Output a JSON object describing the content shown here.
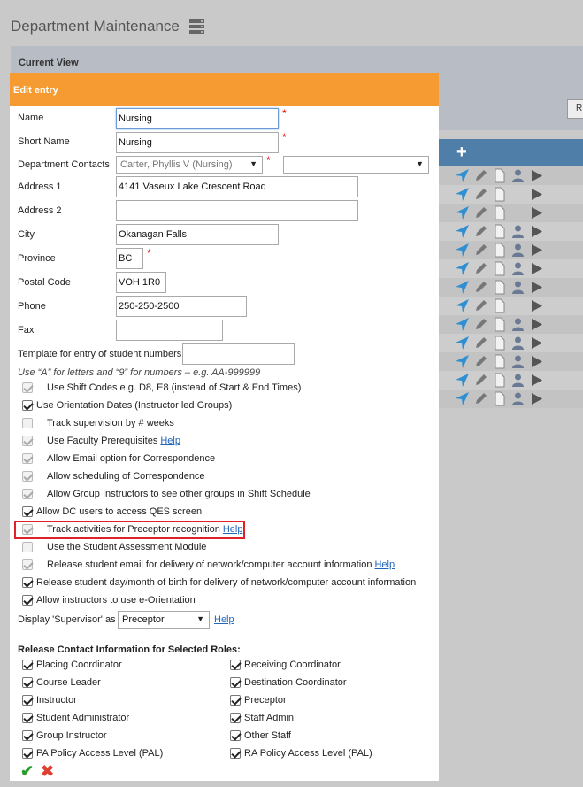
{
  "page": {
    "title": "Department Maintenance"
  },
  "current_view": {
    "label": "Current View",
    "button_label": "R"
  },
  "dialog": {
    "header": "Edit entry",
    "fields": {
      "name": {
        "label": "Name",
        "value": "Nursing"
      },
      "short_name": {
        "label": "Short Name",
        "value": "Nursing"
      },
      "department_contacts": {
        "label": "Department Contacts",
        "value": "Carter, Phyllis V (Nursing)",
        "second_value": ""
      },
      "address1": {
        "label": "Address 1",
        "value": "4141 Vaseux Lake Crescent Road"
      },
      "address2": {
        "label": "Address 2",
        "value": ""
      },
      "city": {
        "label": "City",
        "value": "Okanagan Falls"
      },
      "province": {
        "label": "Province",
        "value": "BC"
      },
      "postal_code": {
        "label": "Postal Code",
        "value": "VOH 1R0"
      },
      "phone": {
        "label": "Phone",
        "value": "250-250-2500"
      },
      "fax": {
        "label": "Fax",
        "value": ""
      },
      "template": {
        "label": "Template for entry of student numbers",
        "value": ""
      }
    },
    "template_hint": "Use “A” for letters and “9” for numbers – e.g. AA-999999",
    "required_mark": "*",
    "options": [
      {
        "label": "Use Shift Codes e.g. D8, E8 (instead of Start & End Times)",
        "checked": true,
        "disabled": true,
        "help": ""
      },
      {
        "label": "Use Orientation Dates (Instructor led Groups)",
        "checked": true,
        "disabled": false,
        "help": ""
      },
      {
        "label": "Track supervision by # weeks",
        "checked": false,
        "disabled": true,
        "help": ""
      },
      {
        "label": "Use Faculty Prerequisites",
        "checked": true,
        "disabled": true,
        "help": "Help"
      },
      {
        "label": "Allow Email option for Correspondence",
        "checked": true,
        "disabled": true,
        "help": ""
      },
      {
        "label": "Allow scheduling of Correspondence",
        "checked": true,
        "disabled": true,
        "help": ""
      },
      {
        "label": "Allow Group Instructors to see other groups in Shift Schedule",
        "checked": true,
        "disabled": true,
        "help": ""
      },
      {
        "label": "Allow DC users to access QES screen",
        "checked": true,
        "disabled": false,
        "help": ""
      },
      {
        "label": "Track activities for Preceptor recognition",
        "checked": true,
        "disabled": true,
        "help": "Help"
      },
      {
        "label": "Use the Student Assessment Module",
        "checked": false,
        "disabled": true,
        "help": ""
      },
      {
        "label": "Release student email for delivery of network/computer account information",
        "checked": true,
        "disabled": true,
        "help": "Help"
      },
      {
        "label": "Release student day/month of birth for delivery of network/computer account information",
        "checked": true,
        "disabled": false,
        "help": ""
      },
      {
        "label": "Allow instructors to use e-Orientation",
        "checked": true,
        "disabled": false,
        "help": ""
      }
    ],
    "supervisor": {
      "label": "Display 'Supervisor' as",
      "value": "Preceptor",
      "help": "Help"
    },
    "roles_title": "Release Contact Information for Selected Roles:",
    "roles_left": [
      "Placing Coordinator",
      "Course Leader",
      "Instructor",
      "Student Administrator",
      "Group Instructor",
      "PA Policy Access Level (PAL)"
    ],
    "roles_right": [
      "Receiving Coordinator",
      "Destination Coordinator",
      "Preceptor",
      "Staff Admin",
      "Other Staff",
      "RA Policy Access Level (PAL)"
    ],
    "ok_icon": "check-icon",
    "cancel_icon": "close-icon"
  },
  "grid": {
    "add_icon": "plus-icon",
    "row_count": 13
  },
  "colors": {
    "header_orange": "#f69b31",
    "grid_header_blue": "#4f7fa8",
    "highlight_red": "#e0202a"
  }
}
